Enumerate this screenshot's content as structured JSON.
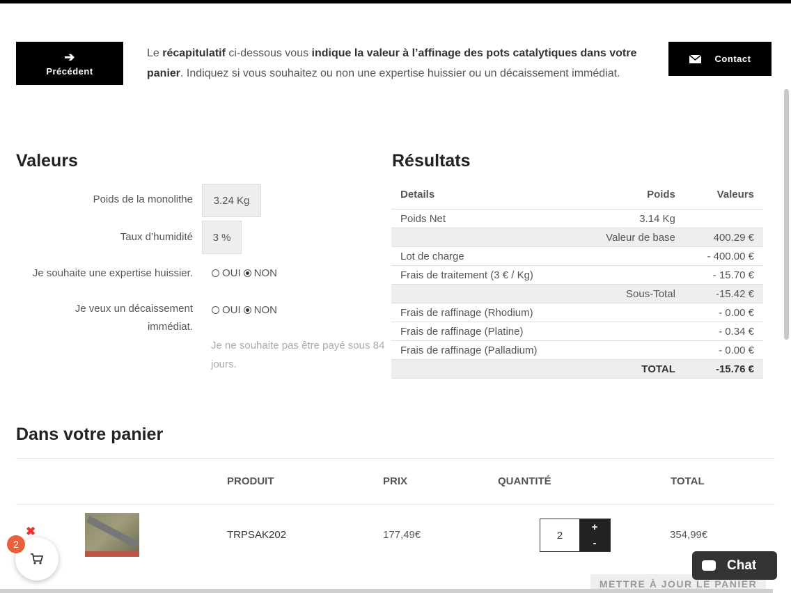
{
  "header": {
    "prev_label": "Précédent",
    "prev_icon": "arrow-left-icon",
    "contact_label": "Contact",
    "contact_icon": "envelope-icon"
  },
  "intro": {
    "t1": "Le ",
    "b1": "récapitulatif",
    "t2": " ci-dessous vous ",
    "b2": "indique la valeur à l’affinage des pots catalytiques dans votre panier",
    "t3": ". Indiquez si vous souhaitez ou non une expertise huissier ou un décaissement immédiat."
  },
  "valeurs": {
    "title": "Valeurs",
    "poids_label": "Poids de la monolithe",
    "poids_value": "3.24 Kg",
    "humidite_label": "Taux d’humidité",
    "humidite_value": "3 %",
    "expertise_label": "Je souhaite une expertise huissier.",
    "decaissement_label": "Je veux un décaissement immédiat.",
    "oui": "OUI",
    "non": "NON",
    "hint": "Je ne souhaite pas être payé sous 84 jours."
  },
  "resultats": {
    "title": "Résultats",
    "headers": [
      "Details",
      "Poids",
      "Valeurs"
    ],
    "rows": [
      [
        "Poids Net",
        "3.14 Kg",
        ""
      ],
      [
        "",
        "Valeur de base",
        "400.29 €"
      ],
      [
        "Lot de charge",
        "",
        "- 400.00 €"
      ],
      [
        "Frais de traitement (3 € / Kg)",
        "",
        "- 15.70 €"
      ],
      [
        "",
        "Sous-Total",
        "-15.42 €"
      ],
      [
        "Frais de raffinage (Rhodium)",
        "",
        "- 0.00 €"
      ],
      [
        "Frais de raffinage (Platine)",
        "",
        "- 0.34 €"
      ],
      [
        "Frais de raffinage (Palladium)",
        "",
        "- 0.00 €"
      ],
      [
        "",
        "TOTAL",
        "-15.76 €"
      ]
    ]
  },
  "cart": {
    "title": "Dans votre panier",
    "headers": {
      "produit": "PRODUIT",
      "prix": "PRIX",
      "quantite": "QUANTITÉ",
      "total": "TOTAL"
    },
    "item": {
      "name": "TRPSAK202",
      "price": "177,49€",
      "qty": "2",
      "total": "354,99€"
    },
    "plus": "+",
    "minus": "-",
    "update_label": "METTRE À JOUR LE PANIER"
  },
  "floating": {
    "badge_count": "2",
    "close_glyph": "✖",
    "chat_label": "Chat"
  }
}
